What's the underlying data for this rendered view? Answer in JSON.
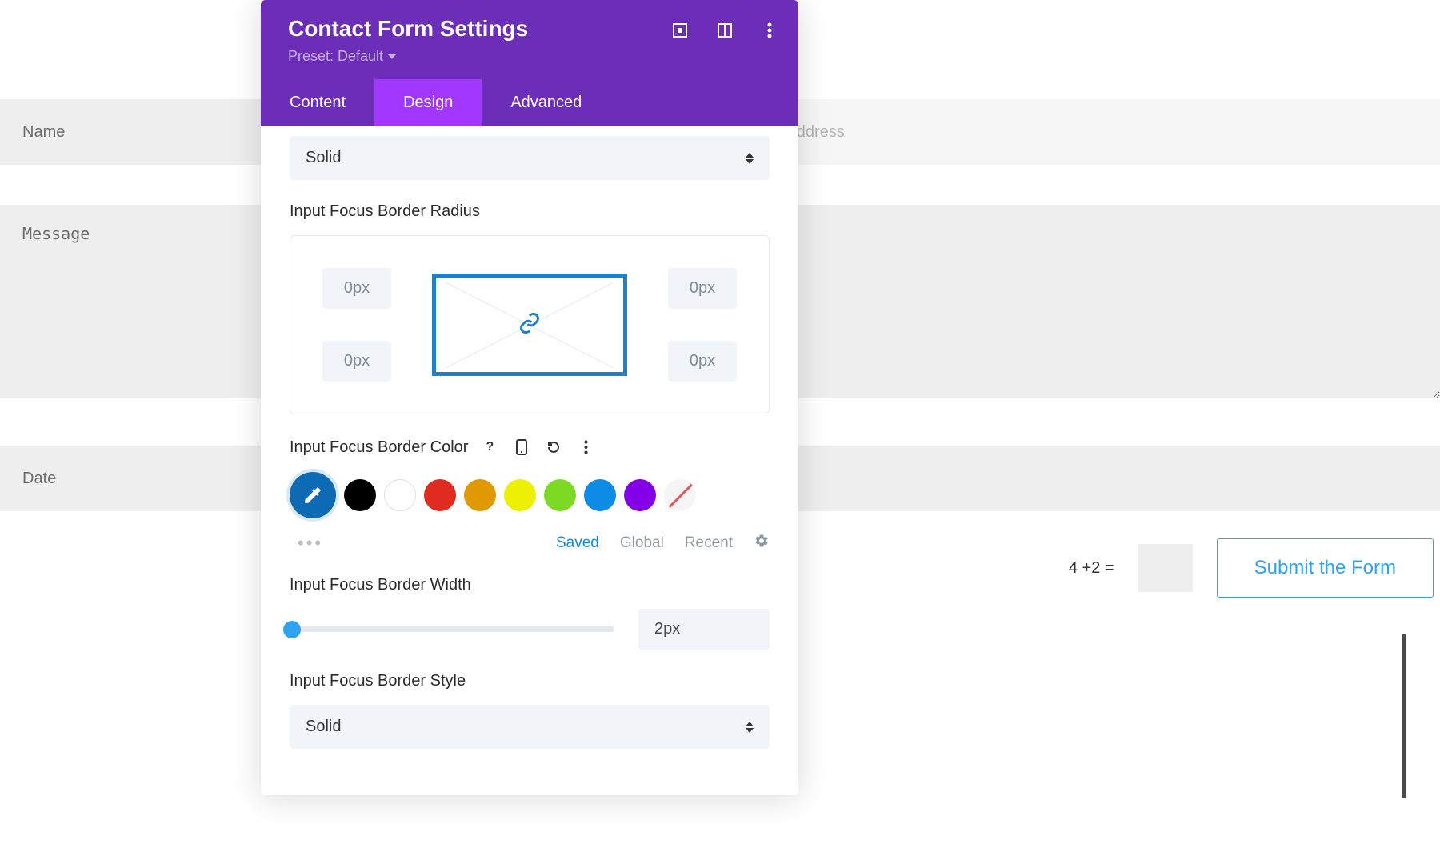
{
  "form": {
    "name_placeholder": "Name",
    "email_placeholder": "Email Address",
    "message_placeholder": "Message",
    "date_placeholder": "Date",
    "captcha_prompt": "4 +2 =",
    "submit_label": "Submit the Form"
  },
  "panel": {
    "title": "Contact Form Settings",
    "preset_label": "Preset: Default",
    "tabs": {
      "content": "Content",
      "design": "Design",
      "advanced": "Advanced"
    },
    "border_style_top_value": "Solid",
    "radius_label": "Input Focus Border Radius",
    "radius": {
      "tl": "0px",
      "tr": "0px",
      "bl": "0px",
      "br": "0px"
    },
    "color_label": "Input Focus Border Color",
    "colors": {
      "black": "#000000",
      "white": "#ffffff",
      "red": "#e02b20",
      "orange": "#e09900",
      "yellow": "#edf000",
      "green": "#7cda24",
      "blue": "#0d8be6",
      "purple": "#8300e9"
    },
    "color_tabs": {
      "saved": "Saved",
      "global": "Global",
      "recent": "Recent"
    },
    "width_label": "Input Focus Border Width",
    "width_value": "2px",
    "style_label": "Input Focus Border Style",
    "style_value": "Solid"
  }
}
